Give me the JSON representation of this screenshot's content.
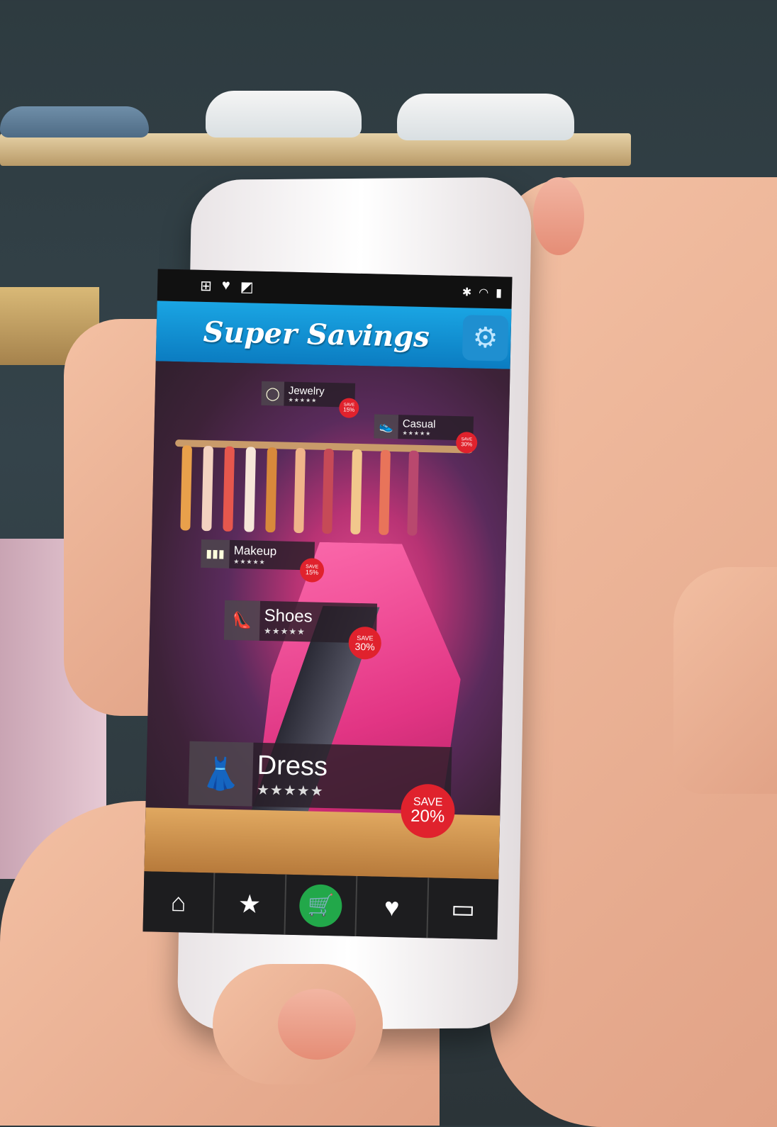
{
  "app": {
    "title": "Super Savings",
    "settings_icon": "gear-icon"
  },
  "status_bar": {
    "left_icons": [
      "network-icon",
      "heart-icon",
      "edit-icon"
    ],
    "right_icons": [
      "bluetooth-icon",
      "wifi-icon",
      "signal-icon"
    ]
  },
  "tags": [
    {
      "label": "Jewelry",
      "icon": "necklace-icon",
      "stars": "★★★★★",
      "save_line1": "SAVE",
      "save_line2": "15%"
    },
    {
      "label": "Casual",
      "icon": "sneaker-icon",
      "stars": "★★★★★",
      "save_line1": "SAVE",
      "save_line2": "30%"
    },
    {
      "label": "Makeup",
      "icon": "makeup-icon",
      "stars": "★★★★★",
      "save_line1": "SAVE",
      "save_line2": "15%"
    },
    {
      "label": "Shoes",
      "icon": "shoe-icon",
      "stars": "★★★★★",
      "save_line1": "SAVE",
      "save_line2": "30%"
    },
    {
      "label": "Dress",
      "icon": "dress-icon",
      "stars": "★★★★★",
      "save_line1": "SAVE",
      "save_line2": "20%"
    }
  ],
  "nav": [
    {
      "name": "home",
      "icon": "home-icon",
      "glyph": "⌂"
    },
    {
      "name": "favorites",
      "icon": "star-icon",
      "glyph": "★"
    },
    {
      "name": "cart",
      "icon": "cart-icon",
      "glyph": "🛒"
    },
    {
      "name": "chat",
      "icon": "chat-heart-icon",
      "glyph": "♥"
    },
    {
      "name": "window",
      "icon": "window-icon",
      "glyph": "▭"
    }
  ],
  "colors": {
    "topbar": "#1aa5e3",
    "badge": "#e0222d",
    "cart": "#22a84a",
    "navbar": "#1d1d1f"
  }
}
